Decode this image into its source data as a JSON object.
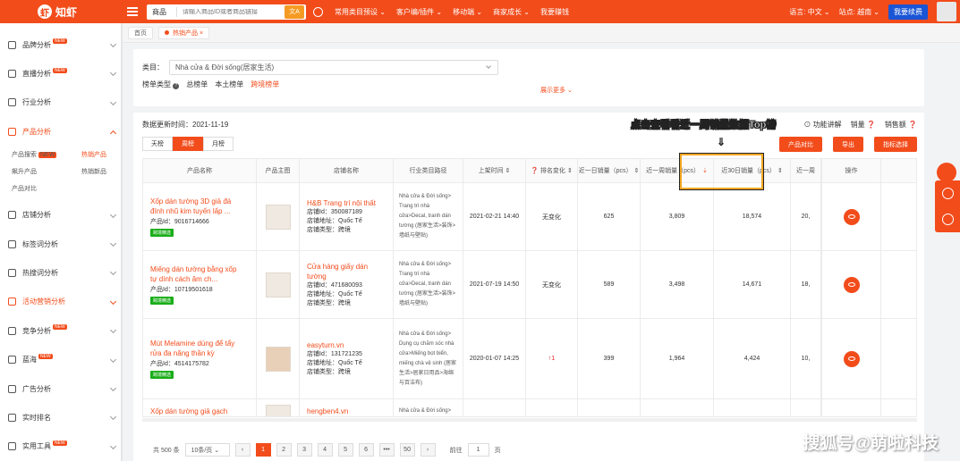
{
  "topbar": {
    "logo_text": "知虾",
    "search_category": "商品",
    "search_placeholder": "请输入商品ID或者商品链接",
    "lang_btn": "文A",
    "nav": [
      "常用类目预设 ⌄",
      "客户编/插件 ⌄",
      "移动端 ⌄",
      "商家成长 ⌄",
      "我要赚钱"
    ],
    "language": "语言: 中文 ⌄",
    "site": "站点: 越南 ⌄",
    "vip": "我要续费"
  },
  "sidebar": {
    "items": [
      {
        "label": "品牌分析",
        "badge": "NEW",
        "active": false
      },
      {
        "label": "直播分析",
        "badge": "NEW",
        "active": false
      },
      {
        "label": "行业分析",
        "badge": "",
        "active": false
      },
      {
        "label": "产品分析",
        "badge": "",
        "active": true
      }
    ],
    "subitems": [
      {
        "label": "产品搜索",
        "badge": "NEW",
        "hot": false
      },
      {
        "label": "热销产品",
        "badge": "",
        "hot": true
      },
      {
        "label": "飙升产品",
        "badge": "",
        "hot": false
      },
      {
        "label": "热销新品",
        "badge": "",
        "hot": false
      },
      {
        "label": "产品对比",
        "badge": "",
        "hot": false
      }
    ],
    "items_after": [
      {
        "label": "店铺分析",
        "badge": "",
        "hot": false
      },
      {
        "label": "标签词分析",
        "badge": "",
        "hot": false
      },
      {
        "label": "热搜词分析",
        "badge": "",
        "hot": false
      },
      {
        "label": "活动营销分析",
        "badge": "",
        "hot": true
      },
      {
        "label": "竞争分析",
        "badge": "NEW",
        "hot": false
      },
      {
        "label": "蓝海",
        "badge": "NEW",
        "hot": false
      },
      {
        "label": "广告分析",
        "badge": "",
        "hot": false
      },
      {
        "label": "实时排名",
        "badge": "",
        "hot": false
      },
      {
        "label": "实用工具",
        "badge": "NEW",
        "hot": false
      }
    ]
  },
  "tabs": {
    "home": "首页",
    "current": "热销产品 ×"
  },
  "filter": {
    "category_label": "类目：",
    "category_value": "Nhà cửa & Đời sống(居家生活)",
    "rank_type_label": "榜单类型",
    "rank_types": [
      "总榜单",
      "本土榜单",
      "跨境榜单"
    ],
    "selected_rank_type": "跨境榜单",
    "show_more": "展示更多 ⌄"
  },
  "main": {
    "update_time": "数据更新时间：2021-11-19",
    "tools": [
      "⊙ 功能讲解",
      "销量 ❓",
      "销售额 ❓"
    ],
    "periods": [
      "天榜",
      "周榜",
      "月榜"
    ],
    "active_period": "周榜",
    "actions": [
      "产品对比",
      "导出",
      "指标选择"
    ],
    "hint": "点击查看看近一周销量数据Top榜",
    "hint_arrow": "⇓"
  },
  "table": {
    "headers": {
      "name": "产品名称",
      "img": "产品主图",
      "shop": "店铺名称",
      "cat": "行业类目路径",
      "date": "上架时间 ⇕",
      "rank": "❓ 排名变化 ⇕",
      "day": "近一日销量（pcs） ⇕",
      "week": "近一周销量（pcs）",
      "week_sort": "⇣",
      "month": "近30日销量（pcs） ⇕",
      "last": "近一周",
      "op": "操作"
    },
    "rows": [
      {
        "title": "Xốp dán tường 3D giả đá đính nhũ kim tuyến lấp ...",
        "id": "产品Id：9016714666",
        "tag": "跨境精选",
        "shop": "H&B Trang trí nội thất",
        "shop_id": "店铺Id：350087189",
        "shop_addr": "店铺地址：Quốc Tế",
        "shop_type": "店铺类型：跨境",
        "cat": "Nhà cửa & Đời sống> Trang trí nhà cửa>Decal, tranh dán tường (居家生活>装饰>墙纸与壁贴)",
        "date": "2021-02-21 14:40",
        "rank": "无变化",
        "day": "625",
        "week": "3,809",
        "month": "18,574",
        "last": "20,"
      },
      {
        "title": "Miếng dán tường bằng xốp tự dính cách âm ch...",
        "id": "产品Id：10719501618",
        "tag": "跨境精选",
        "shop": "Cửa hàng giấy dán tường",
        "shop_id": "店铺Id：471680093",
        "shop_addr": "店铺地址：Quốc Tế",
        "shop_type": "店铺类型：跨境",
        "cat": "Nhà cửa & Đời sống> Trang trí nhà cửa>Decal, tranh dán tường (居家生活>装饰>墙纸与壁贴)",
        "date": "2021-07-19 14:50",
        "rank": "无变化",
        "day": "589",
        "week": "3,498",
        "month": "14,671",
        "last": "18,"
      },
      {
        "title": "Mút Melamine dùng để tẩy rửa đa năng thần kỳ",
        "id": "产品Id：4514175782",
        "tag": "跨境精选",
        "shop": "easyturn.vn",
        "shop_id": "店铺Id：131721235",
        "shop_addr": "店铺地址：Quốc Tế",
        "shop_type": "店铺类型：跨境",
        "cat": "Nhà cửa & Đời sống> Dụng cụ chăm sóc nhà cửa>Miếng bọt biển, miếng chà vệ sinh (居家生活>居家日用品>海绵与百洁布)",
        "date": "2020-01-07 14:25",
        "rank": "↑1",
        "day": "399",
        "week": "1,964",
        "month": "4,424",
        "last": "10,"
      },
      {
        "title": "Xốp dán tường giả gạch",
        "id": "",
        "tag": "",
        "shop": "hengben4.vn",
        "shop_id": "",
        "shop_addr": "",
        "shop_type": "",
        "cat": "Nhà cửa & Đời sống> Trang trí nhà cửa>De",
        "date": "",
        "rank": "",
        "day": "",
        "week": "",
        "month": "",
        "last": ""
      }
    ]
  },
  "pager": {
    "total": "共 500 条",
    "page_size": "10条/页 ⌄",
    "prev": "‹",
    "pages": [
      "1",
      "2",
      "3",
      "4",
      "5",
      "6",
      "•••",
      "50"
    ],
    "next": "›",
    "goto_label": "前往",
    "goto_value": "1",
    "goto_suffix": "页",
    "current": "1"
  },
  "watermark": "搜狐号@萌啦科技",
  "colors": {
    "accent": "#f24c1b",
    "vip": "#1a55d6",
    "tag_green": "#1aad19"
  }
}
